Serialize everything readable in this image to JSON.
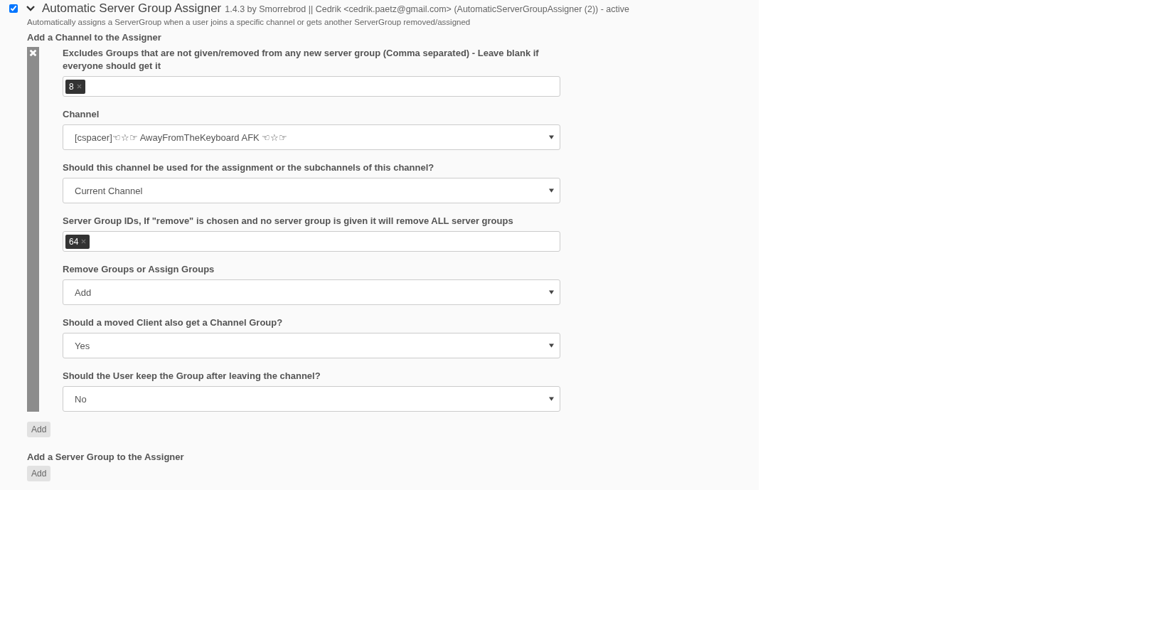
{
  "plugin": {
    "enabled": true,
    "expanded": true,
    "name": "Automatic Server Group Assigner",
    "meta": "1.4.3 by Smorrebrod || Cedrik <cedrik.paetz@gmail.com> (AutomaticServerGroupAssigner (2)) - active",
    "description": "Automatically assigns a ServerGroup when a user joins a specific channel or gets another ServerGroup removed/assigned"
  },
  "channel_section": {
    "title": "Add a Channel to the Assigner",
    "fields": [
      {
        "kind": "tags",
        "label": "Excludes Groups that are not given/removed from any new server group (Comma separated) - Leave blank if everyone should get it",
        "tags": [
          "8"
        ]
      },
      {
        "kind": "select",
        "label": "Channel",
        "value": "[cspacer]☜☆☞ AwayFromTheKeyboard AFK ☜☆☞"
      },
      {
        "kind": "select",
        "label": "Should this channel be used for the assignment or the subchannels of this channel?",
        "value": "Current Channel"
      },
      {
        "kind": "tags",
        "label": "Server Group IDs, If \"remove\" is chosen and no server group is given it will remove ALL server groups",
        "tags": [
          "64"
        ]
      },
      {
        "kind": "select",
        "label": "Remove Groups or Assign Groups",
        "value": "Add"
      },
      {
        "kind": "select",
        "label": "Should a moved Client also get a Channel Group?",
        "value": "Yes"
      },
      {
        "kind": "select",
        "label": "Should the User keep the Group after leaving the channel?",
        "value": "No"
      }
    ],
    "add_button": "Add"
  },
  "server_group_section": {
    "title": "Add a Server Group to the Assigner",
    "add_button": "Add"
  }
}
